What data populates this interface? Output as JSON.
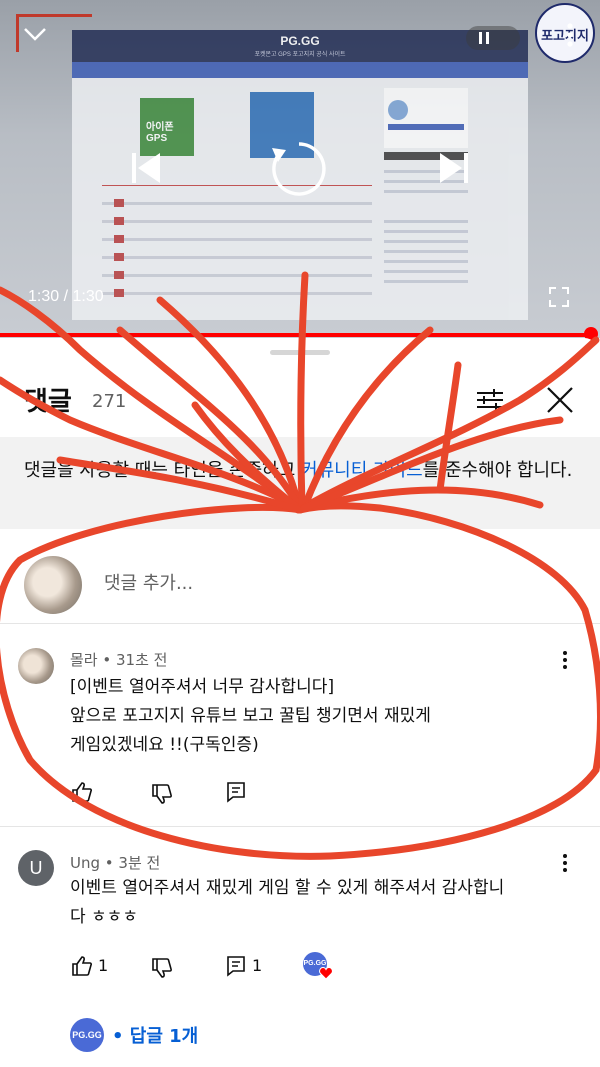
{
  "player": {
    "elapsed": "1:30",
    "duration": "1:30",
    "channel_badge": "포고지지",
    "progress": 1.0,
    "embedded_site": {
      "title": "PG.GG",
      "subtitle": "포켓몬고 GPS 포고지지 공식 사이트",
      "thumbnail_text": "아이폰\nGPS"
    }
  },
  "comments_panel": {
    "title": "댓글",
    "count": "271",
    "guide_prefix": "댓글을 사용할 때는 타인을 존중하고 ",
    "guide_link": "커뮤니티 가이드",
    "guide_suffix": "를 준수해야 합니다.",
    "add_placeholder": "댓글 추가..."
  },
  "comments": [
    {
      "author": "몰라",
      "time": "31초 전",
      "text": "[이벤트 열어주셔서 너무 감사합니다]\n앞으로 포고지지 유튜브 보고 꿀팁 챙기면서 재밌게\n게임있겠네요 !!(구독인증)",
      "likes": "",
      "replies": ""
    },
    {
      "author": "Ung",
      "avatar_letter": "U",
      "time": "3분 전",
      "text": "이벤트 열어주셔서 재밌게 게임 할 수 있게 해주셔서 감사합니\n다 ㅎㅎㅎ",
      "likes": "1",
      "replies": "1",
      "creator_avatar_label": "PG.GG",
      "reply_link": "• 답글 1개"
    }
  ],
  "colors": {
    "accent_red": "#ff0000",
    "scribble_red": "#e8462b",
    "link_blue": "#065fd4"
  },
  "icons": [
    "chevron-down-icon",
    "pause-icon",
    "more-vert-icon",
    "previous-icon",
    "replay-icon",
    "next-icon",
    "fullscreen-icon",
    "filter-icon",
    "close-icon",
    "like-icon",
    "dislike-icon",
    "reply-icon",
    "heart-icon"
  ]
}
